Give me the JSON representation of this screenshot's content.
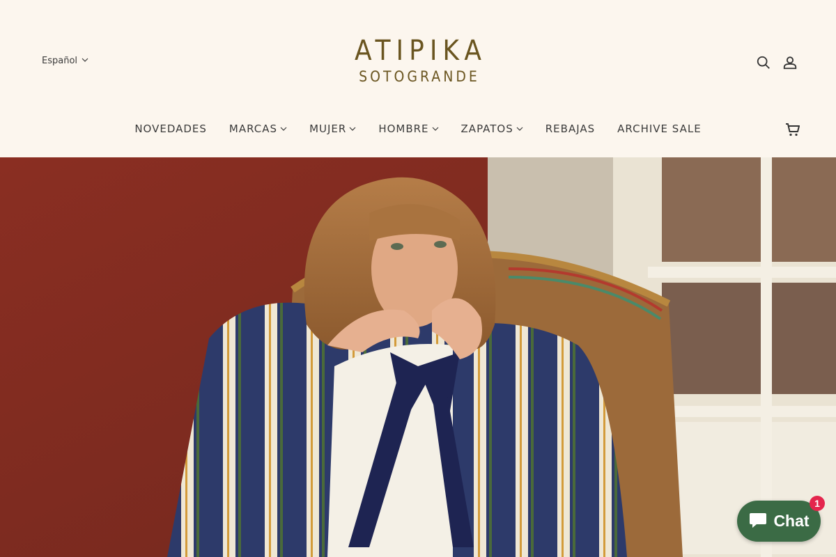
{
  "header": {
    "language_label": "Español",
    "logo_line1": "ATIPIKA",
    "logo_line2": "SOTOGRANDE"
  },
  "nav": {
    "items": [
      {
        "label": "NOVEDADES",
        "has_dropdown": false
      },
      {
        "label": "MARCAS",
        "has_dropdown": true
      },
      {
        "label": "MUJER",
        "has_dropdown": true
      },
      {
        "label": "HOMBRE",
        "has_dropdown": true
      },
      {
        "label": "ZAPATOS",
        "has_dropdown": true
      },
      {
        "label": "REBAJAS",
        "has_dropdown": false
      },
      {
        "label": "ARCHIVE SALE",
        "has_dropdown": false
      }
    ]
  },
  "icons": {
    "search": "search-icon",
    "account": "user-icon",
    "cart": "cart-icon"
  },
  "chat": {
    "label": "Chat",
    "badge_count": "1"
  },
  "colors": {
    "background": "#fcf6ee",
    "logo": "#6a5520",
    "chat": "#3b6b45",
    "badge": "#e4264d"
  }
}
